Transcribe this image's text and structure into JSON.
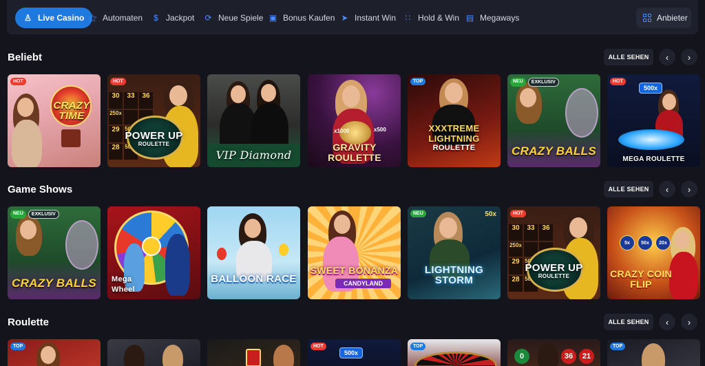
{
  "nav": {
    "tabs": [
      {
        "label": "Live Casino",
        "icon": "dealer-icon",
        "active": true
      },
      {
        "label": "Automaten",
        "icon": "cherries-icon"
      },
      {
        "label": "Jackpot",
        "icon": "moneybag-icon"
      },
      {
        "label": "Neue Spiele",
        "icon": "lightning-icon"
      },
      {
        "label": "Bonus Kaufen",
        "icon": "gift-icon"
      },
      {
        "label": "Instant Win",
        "icon": "rocket-icon"
      },
      {
        "label": "Hold & Win",
        "icon": "dots-grid-icon"
      },
      {
        "label": "Megaways",
        "icon": "cards-icon"
      }
    ],
    "provider_label": "Anbieter"
  },
  "sections": [
    {
      "title": "Beliebt",
      "see_all": "ALLE SEHEN",
      "cards": [
        {
          "logo": "CRAZY TIME",
          "badges": [
            "HOT"
          ]
        },
        {
          "logo": "POWER UP",
          "sub": "ROULETTE",
          "badges": [
            "HOT"
          ],
          "board": [
            "30",
            "33",
            "36",
            "250x",
            "29",
            "500x",
            "28",
            "500x"
          ]
        },
        {
          "logo": "VIP Diamond",
          "badges": []
        },
        {
          "logo": "GRAVITY ROULETTE",
          "badges": [],
          "multipliers": [
            "x1000",
            "x500"
          ]
        },
        {
          "logo": "XXXTREME LIGHTNING",
          "sub": "ROULETTE",
          "badges": [
            "TOP"
          ]
        },
        {
          "logo": "CRAZY BALLS",
          "badges": [
            "NEU",
            "EXKLUSIV"
          ]
        },
        {
          "logo": "MEGA ROULETTE",
          "badges": [
            "HOT"
          ],
          "multiplier": "500x"
        }
      ]
    },
    {
      "title": "Game Shows",
      "see_all": "ALLE SEHEN",
      "cards": [
        {
          "logo": "CRAZY BALLS",
          "badges": [
            "NEU",
            "EXKLUSIV"
          ]
        },
        {
          "logo": "Mega Wheel",
          "badges": []
        },
        {
          "logo": "BALLOON RACE",
          "badges": []
        },
        {
          "logo": "SWEET BONANZA",
          "sub": "CANDYLAND",
          "badges": []
        },
        {
          "logo": "LIGHTNING STORM",
          "badges": [
            "NEU"
          ],
          "multiplier": "50x"
        },
        {
          "logo": "POWER UP",
          "sub": "ROULETTE",
          "badges": [
            "HOT"
          ],
          "board": [
            "30",
            "33",
            "36",
            "250x",
            "29",
            "500x",
            "28",
            "500x"
          ]
        },
        {
          "logo": "CRAZY COIN FLIP",
          "badges": [],
          "multipliers": [
            "5x",
            "50x",
            "20x"
          ]
        }
      ]
    },
    {
      "title": "Roulette",
      "see_all": "ALLE SEHEN",
      "cards": [
        {
          "logo": "",
          "badges": [
            "TOP"
          ]
        },
        {
          "logo": "",
          "badges": []
        },
        {
          "logo": "",
          "badges": []
        },
        {
          "logo": "",
          "badges": [
            "HOT"
          ],
          "multiplier": "500x"
        },
        {
          "logo": "",
          "badges": [
            "TOP"
          ]
        },
        {
          "logo": "",
          "badges": [],
          "numbers": [
            "0",
            "36",
            "21"
          ]
        },
        {
          "logo": "",
          "badges": [
            "TOP"
          ]
        }
      ]
    }
  ],
  "colors": {
    "background": "#14151c",
    "accent": "#1f7ae0",
    "hot": "#ec3b2f",
    "neu": "#2aa53b"
  }
}
